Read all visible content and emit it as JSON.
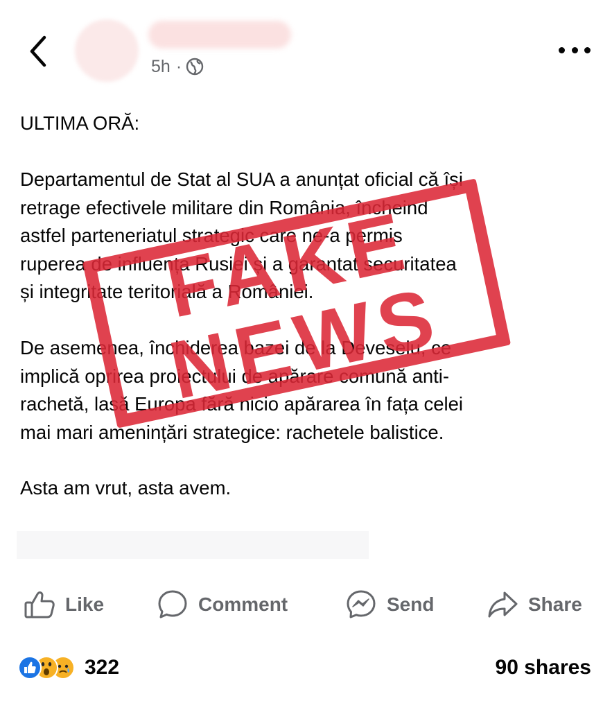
{
  "header": {
    "time": "5h",
    "separator": "·",
    "icons": {
      "back": "back-chevron-icon",
      "visibility": "globe-icon",
      "more": "more-options-icon"
    }
  },
  "post": {
    "lines_p1": [
      "ULTIMA ORĂ:"
    ],
    "lines_p2": [
      "Departamentul de Stat al SUA a anunțat oficial că își",
      "retrage efectivele militare din România, încheind",
      "astfel parteneriatul strategic care ne-a permis",
      "ruperea de influența Rusiei și a garantat securitatea",
      "și integritate teritorială a României."
    ],
    "lines_p3": [
      "De asemenea, închiderea bazei de la Deveselu, ce",
      "implică oprirea proiectului de apărare comună anti-",
      "rachetă, lasă Europa fără nicio apărarea în fața celei",
      "mai mari amenințări strategice: rachetele balistice."
    ],
    "lines_p4": [
      "Asta am vrut, asta avem."
    ]
  },
  "stamp": {
    "line1": "FAKE",
    "line2": "NEWS",
    "color": "#dc2837"
  },
  "actions": {
    "like": "Like",
    "comment": "Comment",
    "send": "Send",
    "share": "Share"
  },
  "footer": {
    "reaction_count": "322",
    "shares": "90 shares",
    "reactions": [
      "like-reaction-icon",
      "wow-reaction-icon",
      "sad-reaction-icon"
    ]
  },
  "colors": {
    "text": "#050505",
    "secondary": "#65676b",
    "like_blue": "#1b74e4",
    "emoji_yellow": "#f7b125"
  }
}
